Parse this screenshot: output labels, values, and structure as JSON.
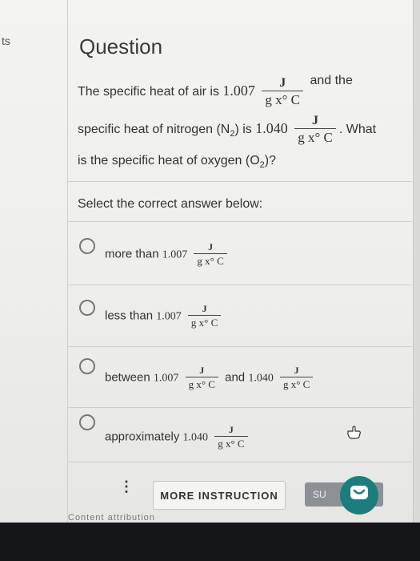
{
  "sidebar": {
    "tab_label": "ts"
  },
  "question": {
    "title": "Question",
    "line1_text": "The specific heat of air is ",
    "air_value": "1.007",
    "line1_after": "and the",
    "line2_text": "specific heat of nitrogen (N",
    "nitrogen_sub": "2",
    "line2_mid": ") is ",
    "nitrogen_value": "1.040",
    "line2_after": ". What",
    "line3_text": "is the specific heat of oxygen (O",
    "oxygen_sub": "2",
    "line3_after": ")?",
    "unit_num": "J",
    "unit_den": "g x° C"
  },
  "prompt": {
    "select_label": "Select the correct answer below:"
  },
  "options": [
    {
      "prefix": "more than ",
      "value": "1.007"
    },
    {
      "prefix": "less than ",
      "value": "1.007"
    },
    {
      "prefix": "between ",
      "value": "1.007",
      "middle": "and ",
      "value2": "1.040"
    },
    {
      "prefix": "approximately ",
      "value": "1.040"
    }
  ],
  "toolbar": {
    "more_label": "MORE INSTRUCTION",
    "kebab": "⋮",
    "submit_label": "SU"
  },
  "footer": {
    "partial_text": "Content attribution"
  },
  "colors": {
    "accent": "#1b7e7c",
    "submit": "#8d9196"
  }
}
